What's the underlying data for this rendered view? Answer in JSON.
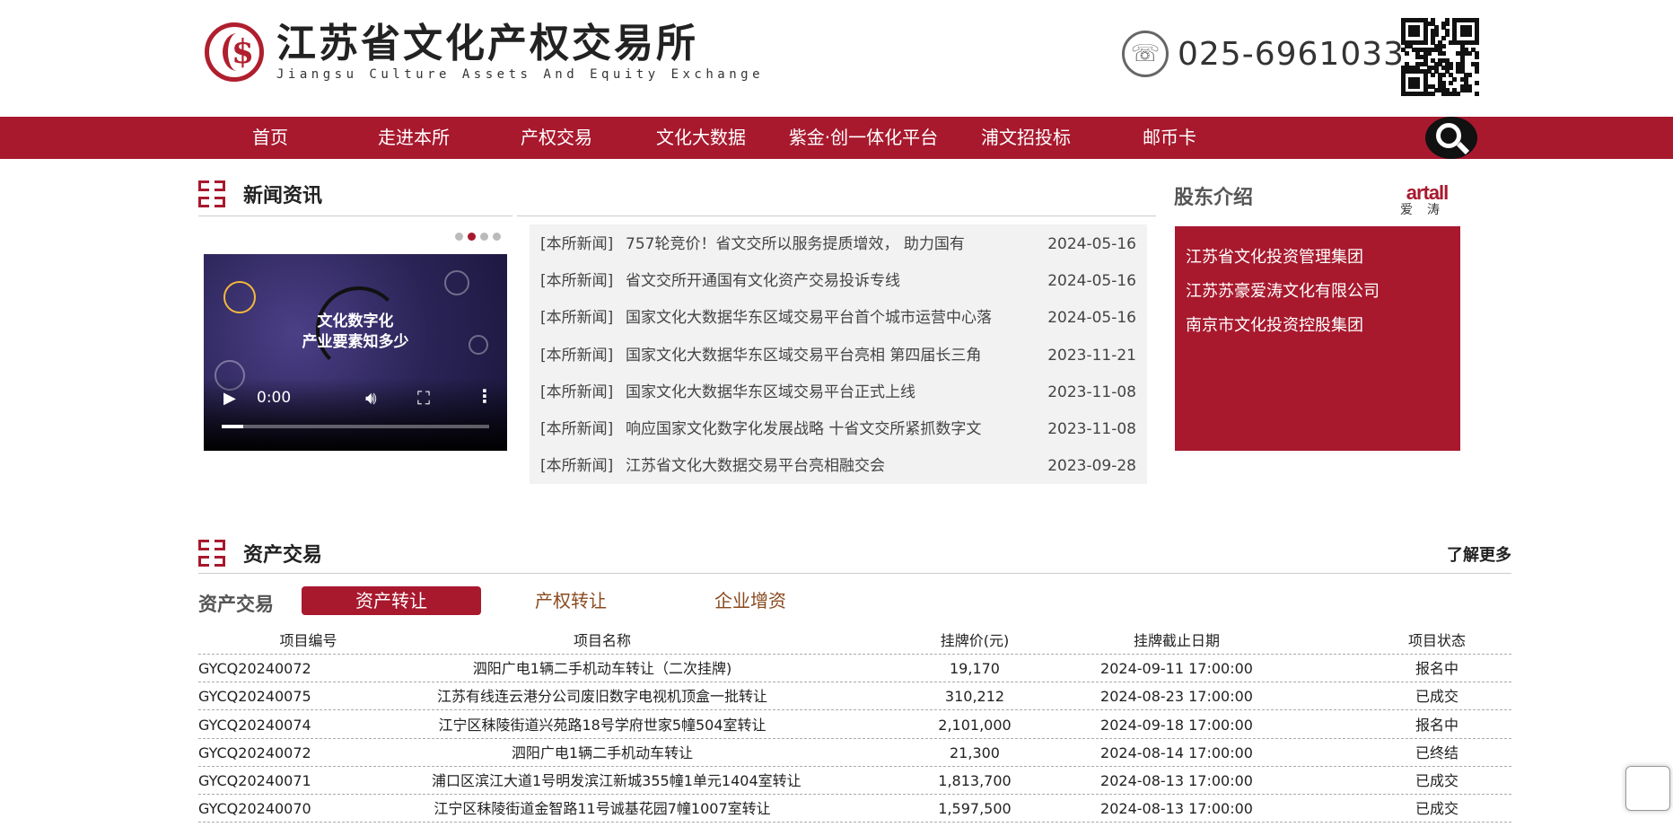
{
  "header": {
    "logo_cn": "江苏省文化产权交易所",
    "logo_en": "Jiangsu Culture Assets And Equity Exchange",
    "phone": "025-69610338"
  },
  "nav": {
    "items": [
      "首页",
      "走进本所",
      "产权交易",
      "文化大数据",
      "紫金·创一体化平台",
      "浦文招投标",
      "邮币卡"
    ]
  },
  "news": {
    "section_title": "新闻资讯",
    "video": {
      "caption_line1": "文化数字化",
      "caption_line2": "产业要素知多少",
      "time": "0:00",
      "progress": 0.08
    },
    "slider_dots": 4,
    "slider_active": 1,
    "items": [
      {
        "tag": "[本所新闻]",
        "title": "757轮竞价！省文交所以服务提质增效， 助力国有",
        "date": "2024-05-16"
      },
      {
        "tag": "[本所新闻]",
        "title": "省文交所开通国有文化资产交易投诉专线",
        "date": "2024-05-16"
      },
      {
        "tag": "[本所新闻]",
        "title": "国家文化大数据华东区域交易平台首个城市运营中心落",
        "date": "2024-05-16"
      },
      {
        "tag": "[本所新闻]",
        "title": "国家文化大数据华东区域交易平台亮相 第四届长三角",
        "date": "2023-11-21"
      },
      {
        "tag": "[本所新闻]",
        "title": "国家文化大数据华东区域交易平台正式上线",
        "date": "2023-11-08"
      },
      {
        "tag": "[本所新闻]",
        "title": "响应国家文化数字化发展战略 十省文交所紧抓数字文",
        "date": "2023-11-08"
      },
      {
        "tag": "[本所新闻]",
        "title": "江苏省文化大数据交易平台亮相融交会",
        "date": "2023-09-28"
      }
    ]
  },
  "shareholders": {
    "title": "股东介绍",
    "logo_text": "artall",
    "logo_sub": "爱涛",
    "items": [
      "江苏省文化投资管理集团",
      "江苏苏豪爱涛文化有限公司",
      "南京市文化投资控股集团"
    ]
  },
  "assets": {
    "section_title": "资产交易",
    "more": "了解更多",
    "tabs_label": "资产交易",
    "tabs": [
      "资产转让",
      "产权转让",
      "企业增资"
    ],
    "active_tab": 0,
    "columns": [
      "项目编号",
      "项目名称",
      "挂牌价(元)",
      "挂牌截止日期",
      "项目状态"
    ],
    "rows": [
      {
        "code": "GYCQ20240072",
        "name": "泗阳广电1辆二手机动车转让（二次挂牌)",
        "price": "19,170",
        "deadline": "2024-09-11 17:00:00",
        "status": "报名中"
      },
      {
        "code": "GYCQ20240075",
        "name": "江苏有线连云港分公司废旧数字电视机顶盒一批转让",
        "price": "310,212",
        "deadline": "2024-08-23 17:00:00",
        "status": "已成交"
      },
      {
        "code": "GYCQ20240074",
        "name": "江宁区秣陵街道兴苑路18号学府世家5幢504室转让",
        "price": "2,101,000",
        "deadline": "2024-09-18 17:00:00",
        "status": "报名中"
      },
      {
        "code": "GYCQ20240072",
        "name": "泗阳广电1辆二手机动车转让",
        "price": "21,300",
        "deadline": "2024-08-14 17:00:00",
        "status": "已终结"
      },
      {
        "code": "GYCQ20240071",
        "name": "浦口区滨江大道1号明发滨江新城355幢1单元1404室转让",
        "price": "1,813,700",
        "deadline": "2024-08-13 17:00:00",
        "status": "已成交"
      },
      {
        "code": "GYCQ20240070",
        "name": "江宁区秣陵街道金智路11号诚基花园7幢1007室转让",
        "price": "1,597,500",
        "deadline": "2024-08-13 17:00:00",
        "status": "已成交"
      }
    ]
  },
  "colors": {
    "brand_red": "#a8192e",
    "tab_text": "#8a4a1f",
    "news_bg": "#f2f2f2"
  }
}
